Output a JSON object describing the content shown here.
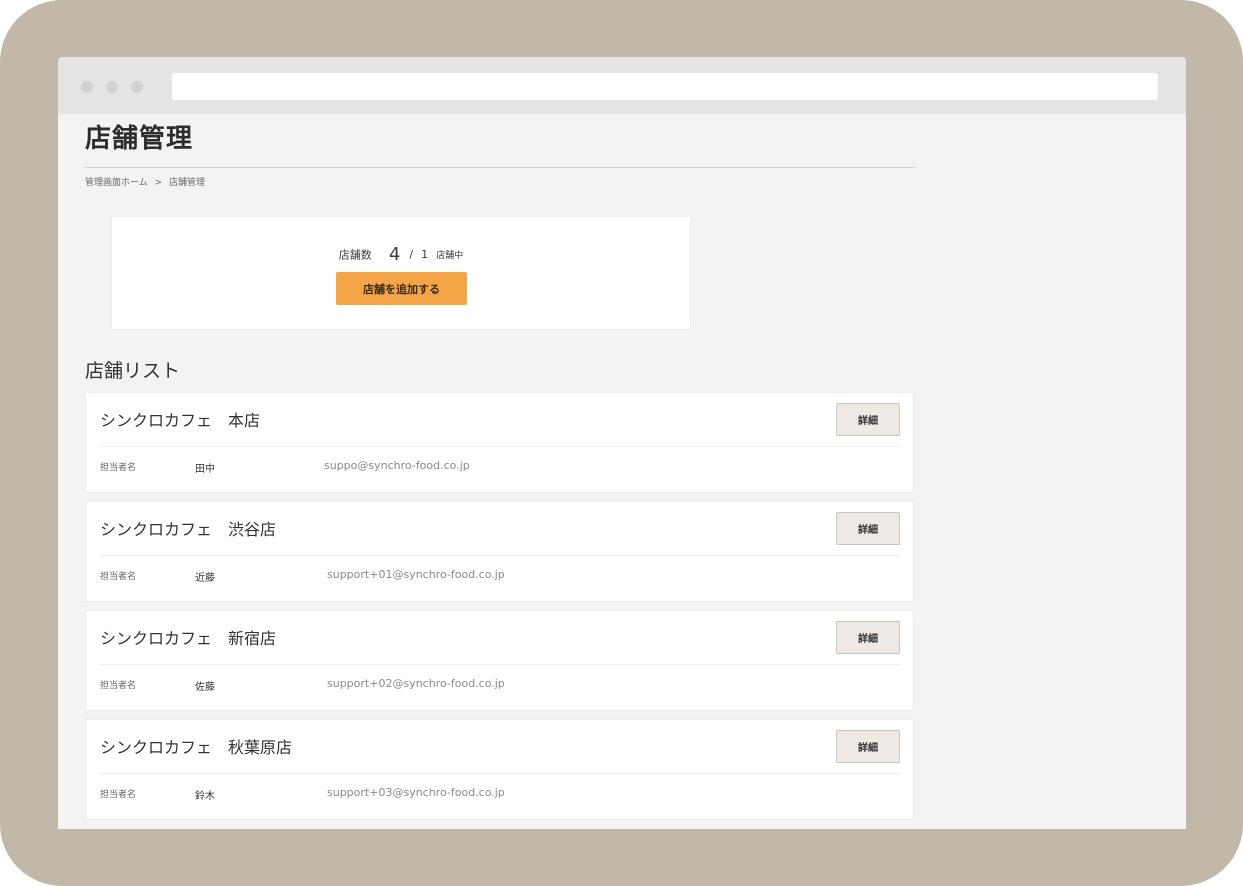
{
  "page": {
    "title": "店舗管理",
    "breadcrumb": [
      "管理画面ホーム",
      ">",
      "店舗管理"
    ]
  },
  "summary": {
    "label": "店舗数",
    "count": "4",
    "separator": "/",
    "total": "1",
    "unit": "店舗中",
    "add_button_label": "店舗を追加する"
  },
  "list": {
    "heading": "店舗リスト",
    "contact_label": "担当者名",
    "detail_label": "詳細",
    "stores": [
      {
        "name": "シンクロカフェ　本店",
        "contact": "田中",
        "email": "suppo@synchro-food.co.jp"
      },
      {
        "name": "シンクロカフェ　渋谷店",
        "contact": "近藤",
        "email": "support+01@synchro-food.co.jp"
      },
      {
        "name": "シンクロカフェ　新宿店",
        "contact": "佐藤",
        "email": "support+02@synchro-food.co.jp"
      },
      {
        "name": "シンクロカフェ　秋葉原店",
        "contact": "鈴木",
        "email": "support+03@synchro-food.co.jp"
      }
    ]
  },
  "colors": {
    "frame": "#c1b8aa",
    "page_background": "#f4f3f1",
    "accent_button": "#f4a548",
    "detail_button": "#eee9e4"
  }
}
